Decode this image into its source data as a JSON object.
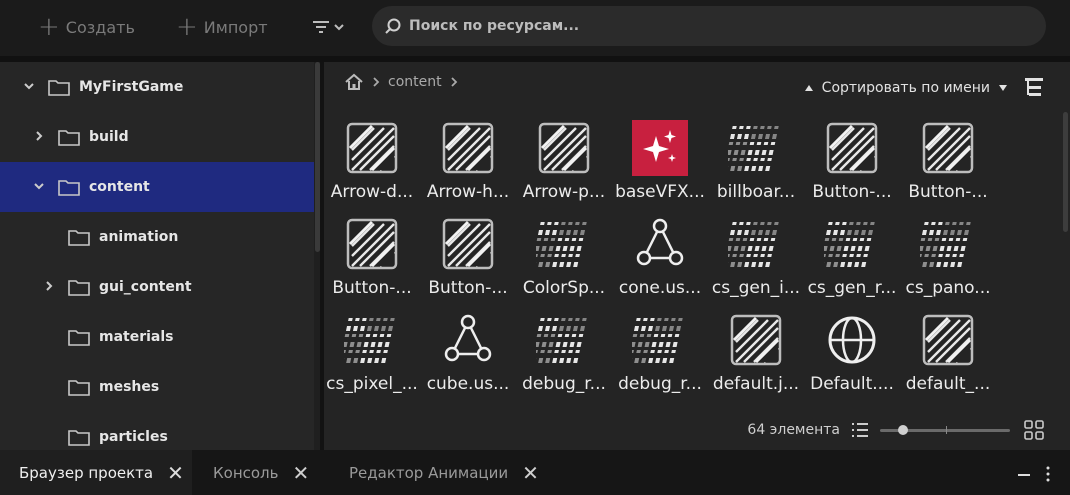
{
  "toolbar": {
    "create_label": "Создать",
    "import_label": "Импорт",
    "search_placeholder": "Поиск по ресурсам..."
  },
  "tree": {
    "items": [
      {
        "label": "MyFirstGame",
        "expanded": true
      },
      {
        "label": "build",
        "expanded": false
      },
      {
        "label": "content",
        "expanded": true,
        "selected": true
      },
      {
        "label": "animation"
      },
      {
        "label": "gui_content",
        "expanded": false
      },
      {
        "label": "materials"
      },
      {
        "label": "meshes"
      },
      {
        "label": "particles"
      }
    ]
  },
  "breadcrumb": {
    "home_icon": "home-icon",
    "current": "content"
  },
  "sort": {
    "label": "Сортировать по имени"
  },
  "assets": [
    {
      "name": "Arrow-d...",
      "icon": "texture"
    },
    {
      "name": "Arrow-h...",
      "icon": "texture"
    },
    {
      "name": "Arrow-p...",
      "icon": "texture"
    },
    {
      "name": "baseVFX...",
      "icon": "vfx"
    },
    {
      "name": "billboar...",
      "icon": "shader"
    },
    {
      "name": "Button-...",
      "icon": "texture"
    },
    {
      "name": "Button-...",
      "icon": "texture"
    },
    {
      "name": "Button-...",
      "icon": "texture"
    },
    {
      "name": "Button-...",
      "icon": "texture"
    },
    {
      "name": "ColorSp...",
      "icon": "shader"
    },
    {
      "name": "cone.us...",
      "icon": "mesh"
    },
    {
      "name": "cs_gen_i...",
      "icon": "shader"
    },
    {
      "name": "cs_gen_r...",
      "icon": "shader"
    },
    {
      "name": "cs_pano...",
      "icon": "shader"
    },
    {
      "name": "cs_pixel_...",
      "icon": "shader"
    },
    {
      "name": "cube.us...",
      "icon": "mesh"
    },
    {
      "name": "debug_r...",
      "icon": "shader"
    },
    {
      "name": "debug_r...",
      "icon": "shader"
    },
    {
      "name": "default.j...",
      "icon": "texture"
    },
    {
      "name": "Default....",
      "icon": "material"
    },
    {
      "name": "default_...",
      "icon": "texture"
    }
  ],
  "footer": {
    "count_label": "64 элемента",
    "thumb_size_fraction": 0.18
  },
  "bottom_tabs": [
    {
      "label": "Браузер проекта",
      "active": true
    },
    {
      "label": "Консоль",
      "active": false
    },
    {
      "label": "Редактор Анимации",
      "active": false
    }
  ],
  "colors": {
    "selection": "#1f2a80",
    "vfx_accent": "#c8203f"
  }
}
